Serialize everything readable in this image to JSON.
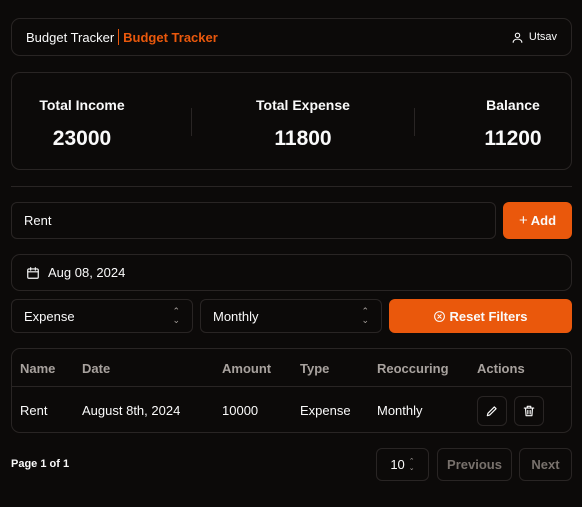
{
  "header": {
    "brand": "Budget Tracker",
    "brand_accent": "Budget Tracker",
    "user_name": "Utsav"
  },
  "stats": {
    "income_label": "Total Income",
    "income_value": "23000",
    "expense_label": "Total Expense",
    "expense_value": "11800",
    "balance_label": "Balance",
    "balance_value": "11200"
  },
  "form": {
    "description_value": "Rent",
    "add_label": "Add",
    "date_value": "Aug 08, 2024",
    "type_value": "Expense",
    "frequency_value": "Monthly",
    "reset_label": "Reset Filters"
  },
  "table": {
    "headers": [
      "Name",
      "Date",
      "Amount",
      "Type",
      "Reoccuring",
      "Actions"
    ],
    "rows": [
      {
        "name": "Rent",
        "date": "August 8th, 2024",
        "amount": "10000",
        "type": "Expense",
        "reoccuring": "Monthly"
      }
    ]
  },
  "pagination": {
    "page_info": "Page 1 of 1",
    "page_size": "10",
    "previous_label": "Previous",
    "next_label": "Next"
  },
  "colors": {
    "accent": "#ea580c",
    "background": "#0c0a09",
    "border": "#292524"
  }
}
